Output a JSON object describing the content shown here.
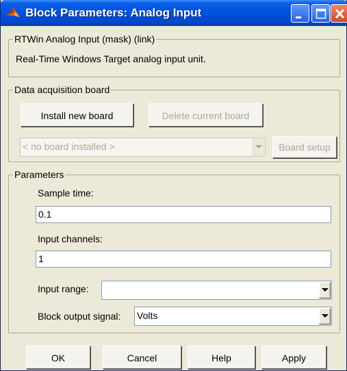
{
  "window": {
    "title": "Block Parameters: Analog Input"
  },
  "mask": {
    "group_label": "RTWin Analog Input (mask) (link)",
    "description": "Real-Time Windows Target analog input unit."
  },
  "daq": {
    "group_label": "Data acquisition board",
    "install_button": "Install new board",
    "delete_button": "Delete current board",
    "board_combo": "< no board installed >",
    "setup_button": "Board setup"
  },
  "params": {
    "group_label": "Parameters",
    "sample_time_label": "Sample time:",
    "sample_time_value": "0.1",
    "channels_label": "Input channels:",
    "channels_value": "1",
    "range_label": "Input range:",
    "range_value": "",
    "output_label": "Block output signal:",
    "output_value": "Volts"
  },
  "buttons": {
    "ok": "OK",
    "cancel": "Cancel",
    "help": "Help",
    "apply": "Apply"
  }
}
